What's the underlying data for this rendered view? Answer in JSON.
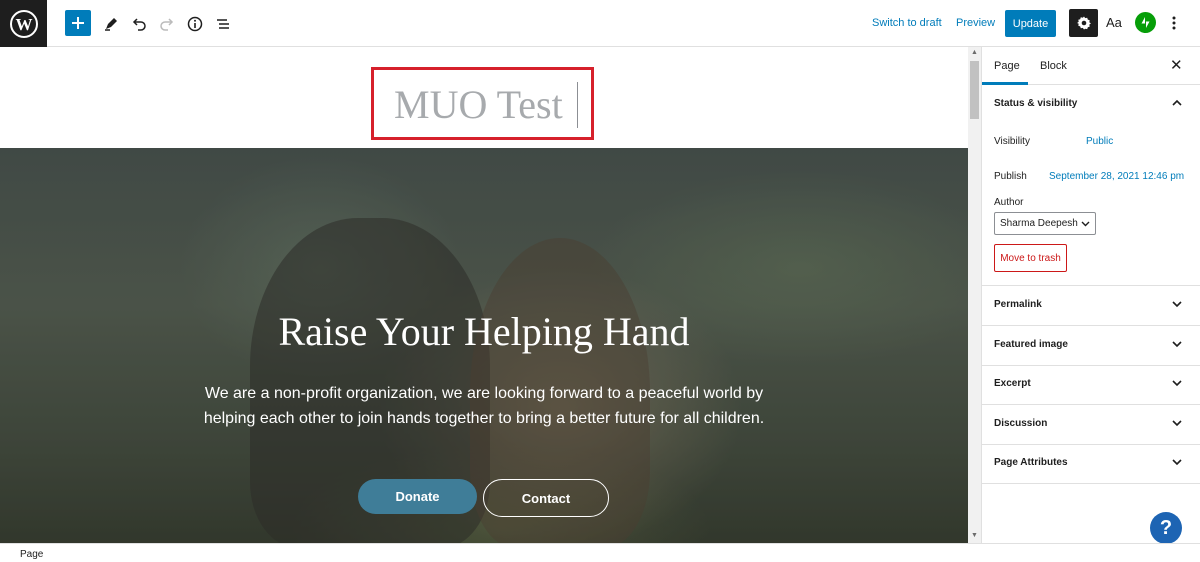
{
  "toolbar": {
    "switch_to_draft": "Switch to draft",
    "preview": "Preview",
    "update": "Update",
    "typography": "Aa"
  },
  "editor": {
    "page_title": "MUO Test",
    "cover": {
      "heading": "Raise Your Helping Hand",
      "text": "We are a non-profit organization, we are looking forward to a peaceful world by helping each other to join hands together to bring a better future for all children.",
      "donate_label": "Donate",
      "contact_label": "Contact"
    }
  },
  "sidebar": {
    "tabs": [
      {
        "label": "Page",
        "active": true
      },
      {
        "label": "Block",
        "active": false
      }
    ],
    "status_visibility": {
      "title": "Status & visibility",
      "expanded": true,
      "visibility_label": "Visibility",
      "visibility_value": "Public",
      "publish_label": "Publish",
      "publish_value": "September 28, 2021 12:46 pm",
      "author_label": "Author",
      "author_value": "Sharma Deepesh",
      "trash_label": "Move to trash"
    },
    "panels": [
      {
        "title": "Permalink"
      },
      {
        "title": "Featured image"
      },
      {
        "title": "Excerpt"
      },
      {
        "title": "Discussion"
      },
      {
        "title": "Page Attributes"
      }
    ],
    "help": "?"
  },
  "footer": {
    "breadcrumb": "Page"
  },
  "colors": {
    "accent": "#007cba",
    "title_highlight": "#d6202b",
    "donate": "#3f7d98",
    "trash": "#cc1818"
  }
}
